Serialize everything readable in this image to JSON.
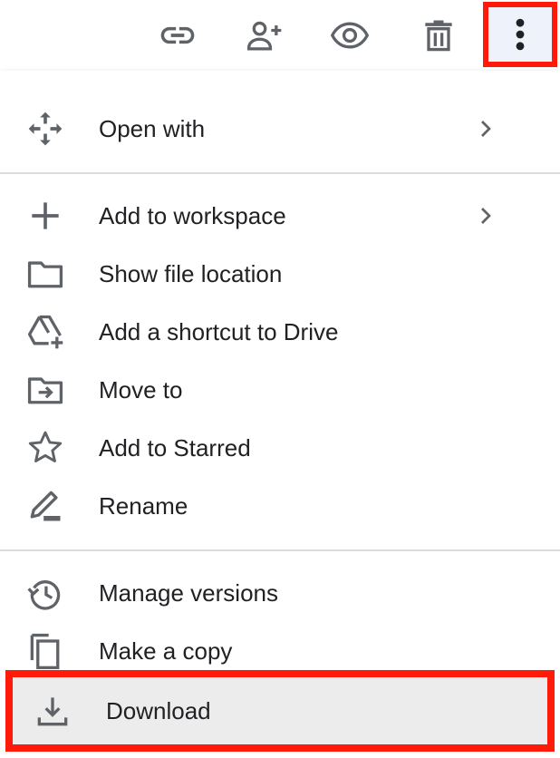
{
  "colors": {
    "highlight_border": "#ff1a0a",
    "icon": "#5f6368",
    "text": "#202124",
    "divider": "#dadce0",
    "hover_bg": "#ececec"
  },
  "toolbar": {
    "icons": [
      "link-icon",
      "add-person-icon",
      "eye-icon",
      "trash-icon",
      "more-vert-icon"
    ]
  },
  "menu": {
    "open_with": {
      "label": "Open with",
      "icon": "open-with-icon"
    },
    "add_to_workspace": {
      "label": "Add to workspace",
      "icon": "plus-icon"
    },
    "show_file_location": {
      "label": "Show file location",
      "icon": "folder-icon"
    },
    "add_shortcut": {
      "label": "Add a shortcut to Drive",
      "icon": "drive-shortcut-icon"
    },
    "move_to": {
      "label": "Move to",
      "icon": "move-folder-icon"
    },
    "add_starred": {
      "label": "Add to Starred",
      "icon": "star-icon"
    },
    "rename": {
      "label": "Rename",
      "icon": "pencil-icon"
    },
    "manage_versions": {
      "label": "Manage versions",
      "icon": "history-icon"
    },
    "make_copy": {
      "label": "Make a copy",
      "icon": "copy-icon"
    },
    "download": {
      "label": "Download",
      "icon": "download-icon"
    }
  }
}
